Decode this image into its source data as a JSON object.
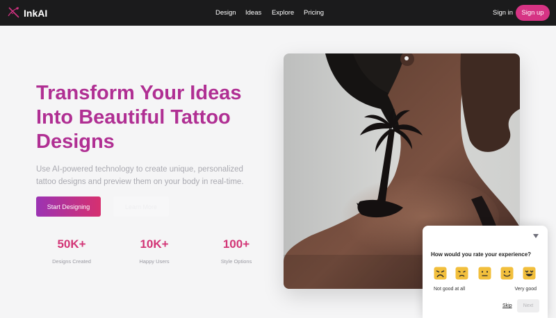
{
  "header": {
    "brand": "InkAI",
    "nav": [
      "Design",
      "Ideas",
      "Explore",
      "Pricing"
    ],
    "signin": "Sign in",
    "signup": "Sign up",
    "accent_color": "#d63384"
  },
  "hero": {
    "title": "Transform Your Ideas Into Beautiful Tattoo Designs",
    "subtitle": "Use AI-powered technology to create unique, personalized tattoo designs and preview them on your body in real-time.",
    "cta_primary": "Start Designing",
    "cta_secondary": "Learn More",
    "title_color": "#b02f93"
  },
  "stats": [
    {
      "value": "50K+",
      "label": "Designs Created"
    },
    {
      "value": "10K+",
      "label": "Happy Users"
    },
    {
      "value": "100+",
      "label": "Style Options"
    }
  ],
  "feedback": {
    "question": "How would you rate your experience?",
    "low_label": "Not good at all",
    "high_label": "Very good",
    "skip": "Skip",
    "next": "Next",
    "faces": [
      "angry-face-icon",
      "sad-face-icon",
      "neutral-face-icon",
      "smile-face-icon",
      "love-face-icon"
    ],
    "face_color": "#f2bf3c"
  }
}
